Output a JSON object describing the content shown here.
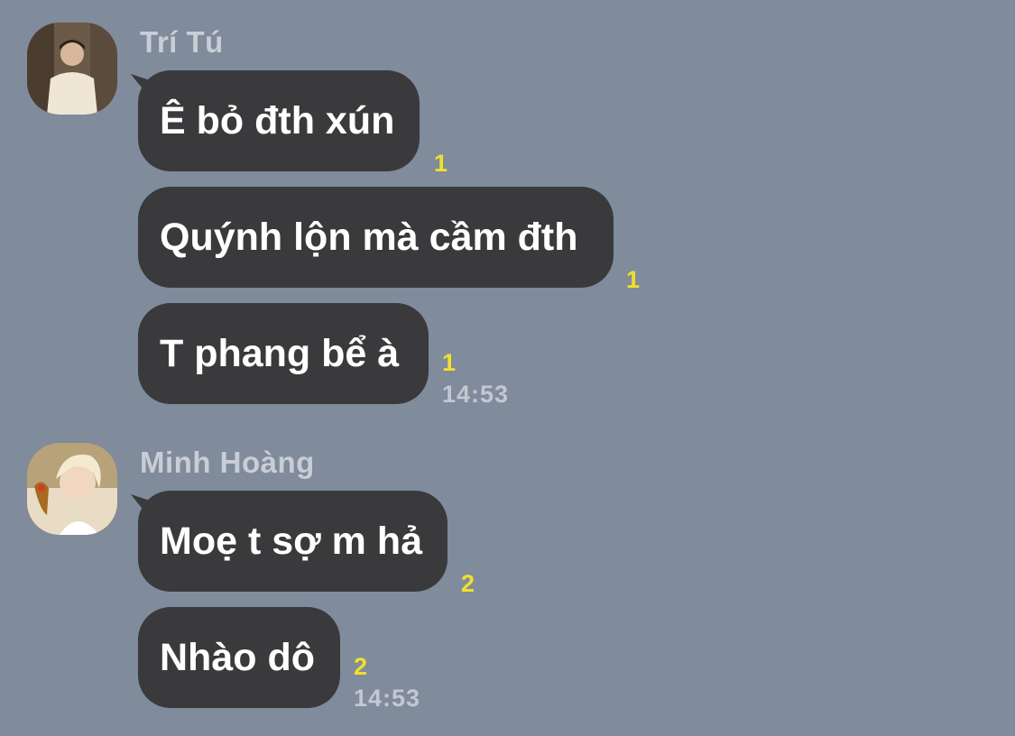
{
  "colors": {
    "background": "#808b9b",
    "bubble": "#3a3a3c",
    "message_text": "#ffffff",
    "sender_name": "#c9ced6",
    "unread_count": "#f1e02d",
    "timestamp": "#c3c8d1"
  },
  "groups": [
    {
      "sender": "Trí Tú",
      "avatar_icon": "user-photo-icon",
      "messages": [
        {
          "text": "Ê bỏ đth xún",
          "unread": "1"
        },
        {
          "text": "Quýnh lộn mà cầm đth",
          "unread": "1"
        },
        {
          "text": "T phang bể à",
          "unread": "1",
          "time": "14:53"
        }
      ]
    },
    {
      "sender": "Minh Hoàng",
      "avatar_icon": "user-photo-icon",
      "messages": [
        {
          "text": "Moẹ t sợ m hả",
          "unread": "2"
        },
        {
          "text": "Nhào dô",
          "unread": "2",
          "time": "14:53"
        }
      ]
    }
  ]
}
